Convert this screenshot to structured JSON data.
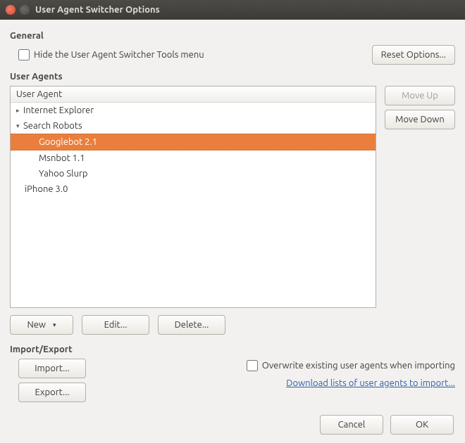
{
  "window_title": "User Agent Switcher Options",
  "sections": {
    "general": "General",
    "user_agents": "User Agents",
    "import_export": "Import/Export"
  },
  "general": {
    "hide_menu_label": "Hide the User Agent Switcher Tools menu",
    "reset_label": "Reset Options..."
  },
  "ua_list": {
    "header": "User Agent",
    "items": [
      {
        "label": "Internet Explorer",
        "level": 1,
        "arrow": "right",
        "selected": false
      },
      {
        "label": "Search Robots",
        "level": 1,
        "arrow": "down",
        "selected": false
      },
      {
        "label": "Googlebot 2.1",
        "level": 2,
        "arrow": "",
        "selected": true
      },
      {
        "label": "Msnbot 1.1",
        "level": 2,
        "arrow": "",
        "selected": false
      },
      {
        "label": "Yahoo Slurp",
        "level": 2,
        "arrow": "",
        "selected": false
      },
      {
        "label": "iPhone 3.0",
        "level": 1,
        "arrow": "",
        "selected": false
      }
    ]
  },
  "side_buttons": {
    "move_up": "Move Up",
    "move_down": "Move Down"
  },
  "ua_buttons": {
    "new": "New",
    "edit": "Edit...",
    "delete": "Delete..."
  },
  "import": {
    "import_btn": "Import...",
    "export_btn": "Export...",
    "overwrite_label": "Overwrite existing user agents when importing",
    "download_link": "Download lists of user agents to import..."
  },
  "footer": {
    "cancel": "Cancel",
    "ok": "OK"
  }
}
